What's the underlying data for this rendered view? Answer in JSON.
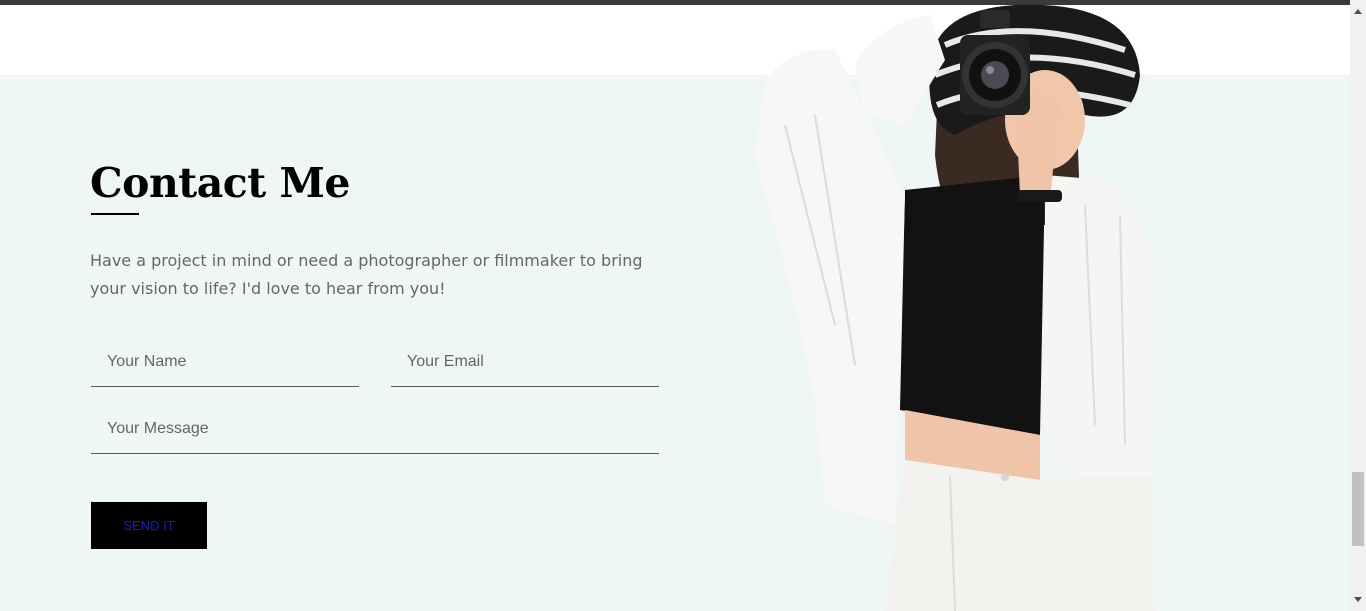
{
  "contact": {
    "heading": "Contact Me",
    "intro": "Have a project in mind or need a photographer or filmmaker to bring your vision to life? I'd love to hear from you!",
    "name_placeholder": "Your Name",
    "email_placeholder": "Your Email",
    "message_placeholder": "Your Message",
    "send_label": "SEND IT"
  },
  "colors": {
    "section_background": "#eef7f5",
    "button_background": "#000000",
    "button_text": "#1a1ad6",
    "body_text": "#666666"
  },
  "icons": {
    "scroll_up": "triangle-up-icon",
    "scroll_down": "triangle-down-icon"
  }
}
